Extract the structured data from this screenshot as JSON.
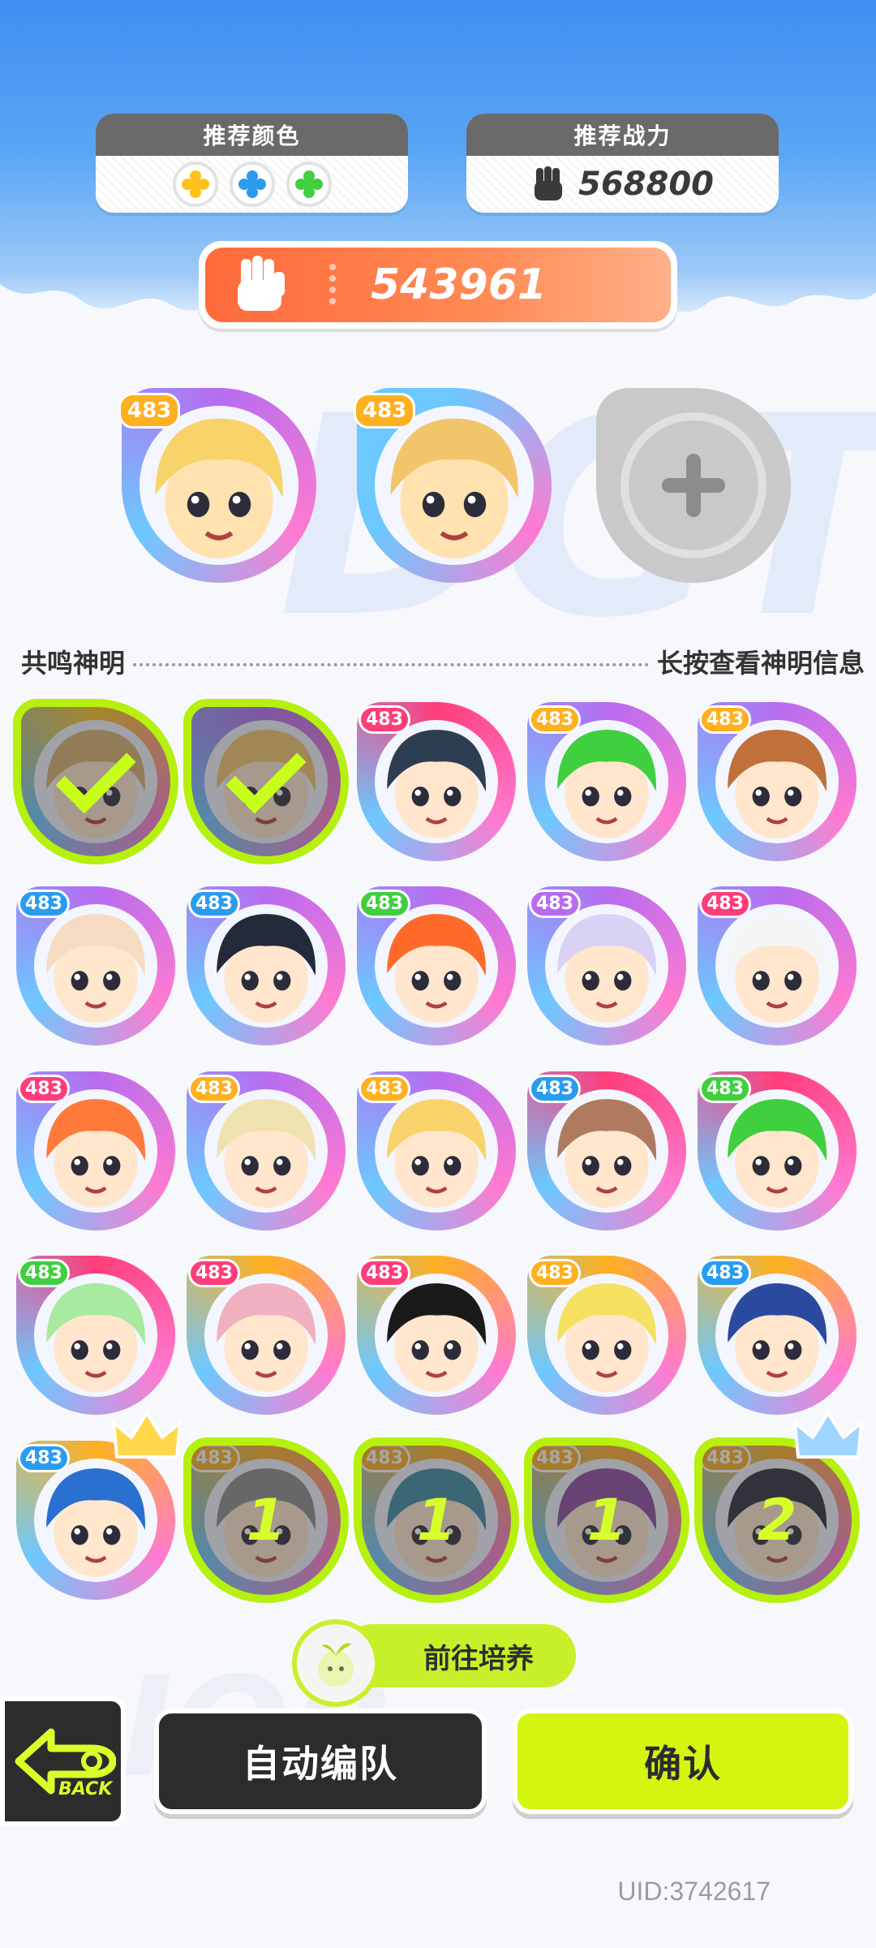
{
  "recommend": {
    "color_title": "推荐颜色",
    "colors": [
      {
        "name": "yellow",
        "hex": "#ffc21a"
      },
      {
        "name": "blue",
        "hex": "#2a9cf0"
      },
      {
        "name": "green",
        "hex": "#3fcf3f"
      }
    ],
    "power_title": "推荐战力",
    "power_value": "568800"
  },
  "team_power": "543961",
  "team_slots": [
    {
      "level": "483",
      "ring": "#b76cf0",
      "skin": "#ffe2b0",
      "hair": "#f7d36a",
      "level_color": "#ffb020"
    },
    {
      "level": "483",
      "ring": "#6cc8ff",
      "skin": "#ffe2b0",
      "hair": "#f2c56a",
      "level_color": "#ffb020"
    },
    {
      "empty": true
    }
  ],
  "section": {
    "title": "共鸣神明",
    "hint": "长按查看神明信息"
  },
  "roster": [
    {
      "level": "483",
      "ring": "#ffc21a",
      "hair": "#d9b070",
      "state": "checked"
    },
    {
      "level": "483",
      "ring": "#b76cf0",
      "hair": "#f2c56a",
      "state": "checked"
    },
    {
      "level": "483",
      "ring": "#ff3d7a",
      "hair": "#2d3e52",
      "level_color": "#ff3d7a"
    },
    {
      "level": "483",
      "ring": "#b76cf0",
      "hair": "#3fcf3f",
      "level_color": "#ffb020"
    },
    {
      "level": "483",
      "ring": "#b76cf0",
      "hair": "#c0703a",
      "level_color": "#ffb020"
    },
    {
      "level": "483",
      "ring": "#b76cf0",
      "hair": "#f5dcc0",
      "level_color": "#2a9cf0"
    },
    {
      "level": "483",
      "ring": "#b76cf0",
      "hair": "#232a3a",
      "level_color": "#2a9cf0"
    },
    {
      "level": "483",
      "ring": "#b76cf0",
      "hair": "#ff6a2a",
      "level_color": "#3fcf3f"
    },
    {
      "level": "483",
      "ring": "#b76cf0",
      "hair": "#d9d2f5",
      "level_color": "#b76cf0"
    },
    {
      "level": "483",
      "ring": "#b76cf0",
      "hair": "#f5f5f5",
      "level_color": "#ff3d7a"
    },
    {
      "level": "483",
      "ring": "#b76cf0",
      "hair": "#ff7a3a",
      "level_color": "#ff3d7a"
    },
    {
      "level": "483",
      "ring": "#b76cf0",
      "hair": "#f0e2b0",
      "level_color": "#ffb020"
    },
    {
      "level": "483",
      "ring": "#b76cf0",
      "hair": "#f7d36a",
      "level_color": "#ffb020"
    },
    {
      "level": "483",
      "ring": "#ff3d7a",
      "hair": "#b07a60",
      "level_color": "#2a9cf0"
    },
    {
      "level": "483",
      "ring": "#ff3d7a",
      "hair": "#3fcf3f",
      "level_color": "#3fcf3f"
    },
    {
      "level": "483",
      "ring": "#ff3d7a",
      "hair": "#a8eaa0",
      "level_color": "#3fcf3f"
    },
    {
      "level": "483",
      "ring": "#ffb020",
      "hair": "#f0b0c0",
      "level_color": "#ff3d7a"
    },
    {
      "level": "483",
      "ring": "#ffb020",
      "hair": "#1a1a1a",
      "level_color": "#ff3d7a"
    },
    {
      "level": "483",
      "ring": "#ffb020",
      "hair": "#f5e060",
      "level_color": "#ffb020"
    },
    {
      "level": "483",
      "ring": "#ffb020",
      "hair": "#2a4aa0",
      "level_color": "#2a9cf0"
    },
    {
      "level": "483",
      "ring": "#ffb020",
      "hair": "#2a70d0",
      "level_color": "#2a9cf0",
      "crown": true
    },
    {
      "level": "483",
      "ring": "#ffb020",
      "hair": "#8a8a8a",
      "state": "numbered",
      "number": "1"
    },
    {
      "level": "483",
      "ring": "#ffb020",
      "hair": "#3a8aa0",
      "state": "numbered",
      "number": "1"
    },
    {
      "level": "483",
      "ring": "#ffb020",
      "hair": "#8a4aa0",
      "state": "numbered",
      "number": "1"
    },
    {
      "level": "483",
      "ring": "#ffb020",
      "hair": "#2a2a3a",
      "state": "numbered",
      "number": "2",
      "crown": true
    }
  ],
  "buttons": {
    "train": "前往培养",
    "back": "BACK",
    "auto": "自动编队",
    "confirm": "确认"
  },
  "uid": "UID:3742617"
}
